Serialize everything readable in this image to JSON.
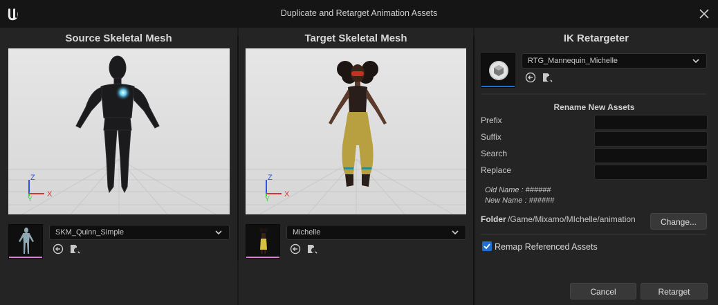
{
  "window": {
    "title": "Duplicate and Retarget Animation Assets"
  },
  "source": {
    "title": "Source Skeletal Mesh",
    "mesh_name": "SKM_Quinn_Simple",
    "axes": {
      "z": "Z",
      "x": "X",
      "y": "Y"
    }
  },
  "target": {
    "title": "Target Skeletal Mesh",
    "mesh_name": "Michelle",
    "axes": {
      "z": "Z",
      "x": "X",
      "y": "Y"
    }
  },
  "retargeter": {
    "title": "IK Retargeter",
    "asset_name": "RTG_Mannequin_Michelle",
    "rename_section": "Rename New Assets",
    "fields": [
      {
        "label": "Prefix",
        "value": ""
      },
      {
        "label": "Suffix",
        "value": ""
      },
      {
        "label": "Search",
        "value": ""
      },
      {
        "label": "Replace",
        "value": ""
      }
    ],
    "old_name": "Old Name : ######",
    "new_name": "New Name : ######",
    "folder_label": "Folder",
    "folder_path": "/Game/Mixamo/MIchelle/animation",
    "change_button": "Change...",
    "remap_label": "Remap Referenced Assets",
    "remap_checked": true
  },
  "buttons": {
    "cancel": "Cancel",
    "retarget": "Retarget"
  },
  "colors": {
    "accent": "#1f6fd0",
    "thumb_bar": "#e07ad8",
    "axis_x": "#e03030",
    "axis_y": "#3ad03a",
    "axis_z": "#2f52e0"
  }
}
